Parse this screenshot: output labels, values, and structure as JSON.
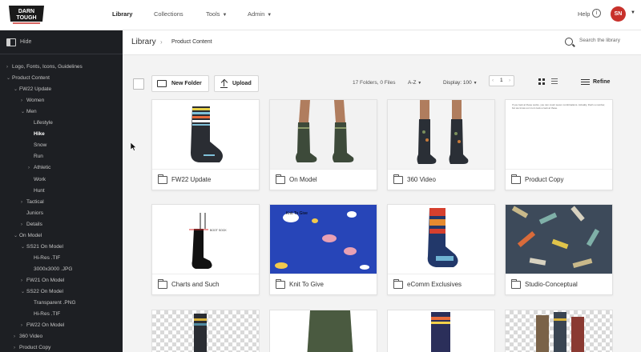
{
  "brand": {
    "logo_text": "DARN TOUGH"
  },
  "topnav": {
    "items": [
      {
        "label": "Library",
        "active": true
      },
      {
        "label": "Collections",
        "active": false
      },
      {
        "label": "Tools",
        "has_caret": true
      },
      {
        "label": "Admin",
        "has_caret": true
      }
    ],
    "help_label": "Help",
    "avatar_initials": "SN"
  },
  "sidebar": {
    "hide_label": "Hide",
    "tree": [
      {
        "label": "Logo, Fonts, Icons, Guidelines",
        "caret": "›"
      },
      {
        "label": "Product Content",
        "caret": "⌄"
      },
      {
        "label": "FW22 Update",
        "caret": "⌄"
      },
      {
        "label": "Women",
        "caret": "›"
      },
      {
        "label": "Men",
        "caret": "⌄"
      },
      {
        "label": "Lifestyle",
        "caret": ""
      },
      {
        "label": "Hike",
        "caret": "",
        "active": true
      },
      {
        "label": "Snow",
        "caret": ""
      },
      {
        "label": "Run",
        "caret": ""
      },
      {
        "label": "Athletic",
        "caret": "›"
      },
      {
        "label": "Work",
        "caret": ""
      },
      {
        "label": "Hunt",
        "caret": ""
      },
      {
        "label": "Tactical",
        "caret": "›"
      },
      {
        "label": "Juniors",
        "caret": ""
      },
      {
        "label": "Details",
        "caret": "›"
      },
      {
        "label": "On Model",
        "caret": "⌄"
      },
      {
        "label": "SS21 On Model",
        "caret": "⌄"
      },
      {
        "label": "Hi-Res .TIF",
        "caret": ""
      },
      {
        "label": "3000x3000 .JPG",
        "caret": ""
      },
      {
        "label": "FW21 On Model",
        "caret": "›"
      },
      {
        "label": "SS22 On Model",
        "caret": "⌄"
      },
      {
        "label": "Transparent .PNG",
        "caret": ""
      },
      {
        "label": "Hi-Res .TIF",
        "caret": ""
      },
      {
        "label": "FW22 On Model",
        "caret": "›"
      },
      {
        "label": "360 Video",
        "caret": "›"
      },
      {
        "label": "Product Copy",
        "caret": "›"
      }
    ]
  },
  "header": {
    "breadcrumb_root": "Library",
    "breadcrumb_sep": "›",
    "breadcrumb_current": "Product Content",
    "search_placeholder": "Search the library"
  },
  "toolbar": {
    "new_folder_label": "New Folder",
    "upload_label": "Upload",
    "count_text": "17 Folders, 0 Files",
    "sort_label": "A-Z",
    "display_label": "Display: 100",
    "page_number": "1",
    "refine_label": "Refine"
  },
  "folders": [
    {
      "title": "FW22 Update",
      "thumb": "sock-stripes"
    },
    {
      "title": "On Model",
      "thumb": "legs-model"
    },
    {
      "title": "360 Video",
      "thumb": "legs-pattern"
    },
    {
      "title": "Product Copy",
      "thumb": "text-doc"
    },
    {
      "title": "Charts and Such",
      "thumb": "boot-sock-chart"
    },
    {
      "title": "Knit To Give",
      "thumb": "blue-pattern"
    },
    {
      "title": "eComm Exclusives",
      "thumb": "sock-red-blue"
    },
    {
      "title": "Studio-Conceptual",
      "thumb": "colorful-pattern"
    }
  ],
  "product_copy_preview": "If you look at these socks, you can count seven combinations. Actually, that's a number, but we know our mom took a look at these.",
  "boot_sock_label": "BOOT SOCK",
  "knit_to_give_label": "Knit To Give",
  "colors": {
    "sidebar_bg": "#1d1f23",
    "avatar_bg": "#c8312b",
    "main_bg": "#f3f3f3"
  }
}
